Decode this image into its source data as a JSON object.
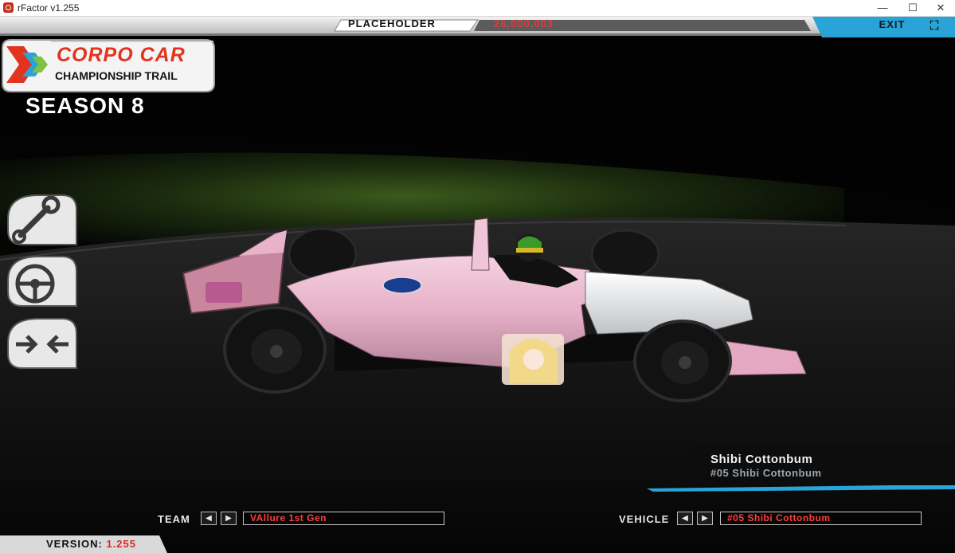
{
  "window": {
    "title": "rFactor v1.255",
    "minimize": "—",
    "maximize": "☐",
    "close": "✕"
  },
  "topbar": {
    "label": "PLACEHOLDER",
    "money": "26,000,003",
    "exit_label": "EXIT",
    "exit_icon": "⛶"
  },
  "logo": {
    "line1": "CORPO CAR",
    "line2": "CHAMPIONSHIP TRAIL"
  },
  "season": "SEASON 8",
  "side_buttons": [
    {
      "icon": "wrench-icon"
    },
    {
      "icon": "steering-wheel-icon"
    },
    {
      "icon": "compare-arrows-icon"
    }
  ],
  "driver": {
    "name": "Shibi Cottonbum",
    "entry": "#05 Shibi Cottonbum"
  },
  "team": {
    "label": "TEAM",
    "value": "VAllure 1st Gen"
  },
  "vehicle": {
    "label": "VEHICLE",
    "value": "#05 Shibi Cottonbum"
  },
  "arrows": {
    "prev": "◀",
    "next": "▶"
  },
  "version": {
    "label": "VERSION:",
    "value": "1.255"
  },
  "colors": {
    "accent_blue": "#2aa3d6",
    "money_red": "#e23a3a",
    "car_pink": "#e8b7cd"
  }
}
